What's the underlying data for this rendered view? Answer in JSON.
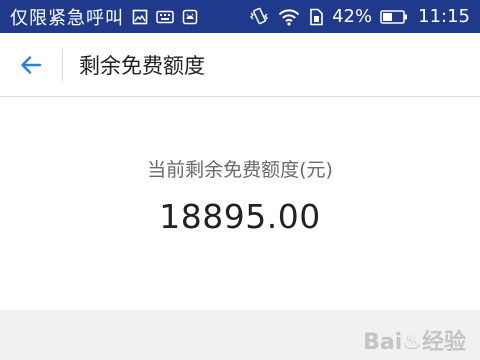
{
  "status_bar": {
    "emergency_text": "仅限紧急呼叫",
    "battery_percent": "42%",
    "time": "11:15",
    "icons": [
      "image-icon",
      "keyboard-icon",
      "android-icon",
      "vibrate-icon",
      "wifi-icon",
      "sim-card-icon",
      "battery-icon"
    ],
    "background_color": "#1f3a8d"
  },
  "app_bar": {
    "title": "剩余免费额度",
    "back_icon": "arrow-left-icon",
    "back_icon_color": "#2a7fe0"
  },
  "quota": {
    "label": "当前剩余免费额度(元)",
    "value": "18895.00"
  },
  "watermark": {
    "text": "Bai♨经验"
  }
}
